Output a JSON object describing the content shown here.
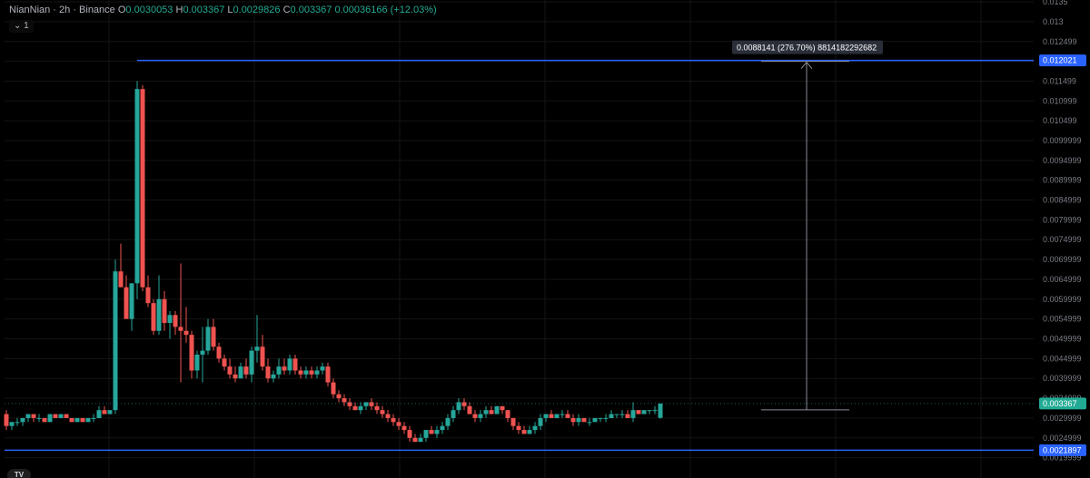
{
  "header": {
    "symbol": "NianNian · 2h · Binance",
    "open_label": "O",
    "open": "0.0030053",
    "high_label": "H",
    "high": "0.003367",
    "low_label": "L",
    "low": "0.0029826",
    "close_label": "C",
    "close": "0.003367",
    "change": "0.00036166 (+12.03%)",
    "collapse_label": "1",
    "collapse_icon": "chevron-down-icon"
  },
  "colors": {
    "up": "#26a69a",
    "down": "#ef5350",
    "bg": "#000000",
    "grid": "#141414",
    "blue_line": "#2962ff",
    "axis_text": "#7a7d85",
    "current_tag": "#22ab94"
  },
  "price_axis": {
    "ticks": [
      "0.0135",
      "0.013",
      "0.012499",
      "0.011999",
      "0.011499",
      "0.010999",
      "0.010499",
      "0.0099999",
      "0.0094999",
      "0.0089999",
      "0.0084999",
      "0.0079999",
      "0.0074999",
      "0.0069999",
      "0.0064999",
      "0.0059999",
      "0.0054999",
      "0.0049999",
      "0.0044999",
      "0.0039999",
      "0.0034999",
      "0.0029999",
      "0.0024999",
      "0.0019999"
    ],
    "upper_line_label": "0.012021",
    "lower_line_label": "0.0021897",
    "current_label": "0.003367"
  },
  "measure": {
    "label": "0.0088141 (276.70%) 8814182292682"
  },
  "logo": {
    "text": "TV"
  },
  "chart_data": {
    "type": "candlestick",
    "symbol": "NianNian",
    "interval": "2h",
    "exchange": "Binance",
    "ylim": [
      0.0019,
      0.0135
    ],
    "horizontal_lines": [
      0.012021,
      0.0021897
    ],
    "measure_from": 0.0032059,
    "measure_to": 0.012021,
    "candles": [
      [
        0.0031,
        0.0032,
        0.0027,
        0.0028
      ],
      [
        0.0028,
        0.0029,
        0.0027,
        0.0029
      ],
      [
        0.0029,
        0.003,
        0.0028,
        0.0029
      ],
      [
        0.0029,
        0.003,
        0.0028,
        0.003
      ],
      [
        0.003,
        0.0031,
        0.0029,
        0.0031
      ],
      [
        0.0031,
        0.0031,
        0.0029,
        0.003
      ],
      [
        0.003,
        0.0031,
        0.0029,
        0.003
      ],
      [
        0.003,
        0.003,
        0.0029,
        0.0029
      ],
      [
        0.0029,
        0.0031,
        0.0029,
        0.0031
      ],
      [
        0.0031,
        0.0031,
        0.003,
        0.003
      ],
      [
        0.003,
        0.0031,
        0.003,
        0.0031
      ],
      [
        0.0031,
        0.0031,
        0.003,
        0.003
      ],
      [
        0.003,
        0.003,
        0.0029,
        0.0029
      ],
      [
        0.0029,
        0.003,
        0.0029,
        0.003
      ],
      [
        0.003,
        0.003,
        0.0029,
        0.0029
      ],
      [
        0.0029,
        0.003,
        0.0029,
        0.003
      ],
      [
        0.003,
        0.0031,
        0.0029,
        0.003
      ],
      [
        0.003,
        0.0033,
        0.003,
        0.0032
      ],
      [
        0.0032,
        0.0033,
        0.0031,
        0.0031
      ],
      [
        0.0031,
        0.0032,
        0.0031,
        0.0032
      ],
      [
        0.0032,
        0.007,
        0.0031,
        0.0067
      ],
      [
        0.0067,
        0.0074,
        0.0065,
        0.0063
      ],
      [
        0.0063,
        0.0066,
        0.0055,
        0.0055
      ],
      [
        0.0055,
        0.0064,
        0.0052,
        0.0064
      ],
      [
        0.0064,
        0.0115,
        0.006,
        0.0113
      ],
      [
        0.0113,
        0.0114,
        0.0062,
        0.0063
      ],
      [
        0.0063,
        0.0066,
        0.0058,
        0.0059
      ],
      [
        0.0059,
        0.006,
        0.0051,
        0.0052
      ],
      [
        0.0052,
        0.0066,
        0.0051,
        0.006
      ],
      [
        0.006,
        0.0062,
        0.0052,
        0.0054
      ],
      [
        0.0054,
        0.0057,
        0.005,
        0.0056
      ],
      [
        0.0056,
        0.0057,
        0.0051,
        0.0053
      ],
      [
        0.0053,
        0.0069,
        0.0039,
        0.0052
      ],
      [
        0.0052,
        0.0058,
        0.0049,
        0.0051
      ],
      [
        0.0051,
        0.0052,
        0.004,
        0.0042
      ],
      [
        0.0042,
        0.0047,
        0.004,
        0.0046
      ],
      [
        0.0046,
        0.0053,
        0.0039,
        0.0047
      ],
      [
        0.0047,
        0.0055,
        0.0046,
        0.0053
      ],
      [
        0.0053,
        0.0055,
        0.0047,
        0.0048
      ],
      [
        0.0048,
        0.0049,
        0.0044,
        0.0045
      ],
      [
        0.0045,
        0.0046,
        0.0042,
        0.0043
      ],
      [
        0.0043,
        0.0045,
        0.004,
        0.0041
      ],
      [
        0.0041,
        0.0043,
        0.0039,
        0.004
      ],
      [
        0.004,
        0.0044,
        0.004,
        0.0043
      ],
      [
        0.0043,
        0.0045,
        0.004,
        0.0041
      ],
      [
        0.0041,
        0.0048,
        0.0039,
        0.0047
      ],
      [
        0.0047,
        0.0056,
        0.0044,
        0.0048
      ],
      [
        0.0048,
        0.0051,
        0.0042,
        0.0043
      ],
      [
        0.0043,
        0.0045,
        0.0039,
        0.004
      ],
      [
        0.004,
        0.0042,
        0.0039,
        0.0041
      ],
      [
        0.0041,
        0.0045,
        0.004,
        0.0043
      ],
      [
        0.0043,
        0.0045,
        0.0041,
        0.0042
      ],
      [
        0.0042,
        0.0046,
        0.0041,
        0.0045
      ],
      [
        0.0045,
        0.0046,
        0.0041,
        0.0042
      ],
      [
        0.0042,
        0.0043,
        0.004,
        0.0041
      ],
      [
        0.0041,
        0.0043,
        0.004,
        0.0042
      ],
      [
        0.0042,
        0.0043,
        0.004,
        0.0041
      ],
      [
        0.0041,
        0.0043,
        0.004,
        0.0042
      ],
      [
        0.0042,
        0.0044,
        0.0041,
        0.0043
      ],
      [
        0.0043,
        0.0044,
        0.0038,
        0.0039
      ],
      [
        0.0039,
        0.004,
        0.0035,
        0.0036
      ],
      [
        0.0036,
        0.0037,
        0.0034,
        0.0035
      ],
      [
        0.0035,
        0.0036,
        0.0033,
        0.0034
      ],
      [
        0.0034,
        0.0035,
        0.0032,
        0.0033
      ],
      [
        0.0033,
        0.0034,
        0.0032,
        0.0032
      ],
      [
        0.0032,
        0.0034,
        0.0031,
        0.0033
      ],
      [
        0.0033,
        0.0034,
        0.0032,
        0.0034
      ],
      [
        0.0034,
        0.0035,
        0.0032,
        0.0033
      ],
      [
        0.0033,
        0.0034,
        0.0031,
        0.0032
      ],
      [
        0.0032,
        0.0033,
        0.003,
        0.0031
      ],
      [
        0.0031,
        0.0032,
        0.0029,
        0.003
      ],
      [
        0.003,
        0.0031,
        0.0028,
        0.0029
      ],
      [
        0.0029,
        0.003,
        0.0027,
        0.0028
      ],
      [
        0.0028,
        0.0029,
        0.0026,
        0.0027
      ],
      [
        0.0027,
        0.0028,
        0.0024,
        0.0025
      ],
      [
        0.0025,
        0.0026,
        0.0024,
        0.0024
      ],
      [
        0.0024,
        0.0026,
        0.0024,
        0.0025
      ],
      [
        0.0025,
        0.0027,
        0.0024,
        0.0027
      ],
      [
        0.0027,
        0.0028,
        0.0026,
        0.0026
      ],
      [
        0.0026,
        0.0028,
        0.0025,
        0.0027
      ],
      [
        0.0027,
        0.0029,
        0.0026,
        0.0028
      ],
      [
        0.0028,
        0.0031,
        0.0027,
        0.003
      ],
      [
        0.003,
        0.0033,
        0.0029,
        0.0032
      ],
      [
        0.0032,
        0.0035,
        0.0031,
        0.0034
      ],
      [
        0.0034,
        0.0035,
        0.0032,
        0.0033
      ],
      [
        0.0033,
        0.0034,
        0.0031,
        0.0031
      ],
      [
        0.0031,
        0.0032,
        0.0029,
        0.003
      ],
      [
        0.003,
        0.0032,
        0.0029,
        0.0031
      ],
      [
        0.0031,
        0.0033,
        0.003,
        0.0032
      ],
      [
        0.0032,
        0.0033,
        0.0031,
        0.0031
      ],
      [
        0.0031,
        0.0033,
        0.0031,
        0.0033
      ],
      [
        0.0033,
        0.0033,
        0.0031,
        0.0032
      ],
      [
        0.0032,
        0.0032,
        0.0029,
        0.003
      ],
      [
        0.003,
        0.003,
        0.0027,
        0.0028
      ],
      [
        0.0028,
        0.0029,
        0.0026,
        0.0027
      ],
      [
        0.0027,
        0.0028,
        0.0026,
        0.0026
      ],
      [
        0.0026,
        0.0028,
        0.0026,
        0.0027
      ],
      [
        0.0027,
        0.0029,
        0.0026,
        0.0028
      ],
      [
        0.0028,
        0.0031,
        0.0027,
        0.003
      ],
      [
        0.003,
        0.0031,
        0.0029,
        0.0031
      ],
      [
        0.0031,
        0.0032,
        0.003,
        0.003
      ],
      [
        0.003,
        0.0031,
        0.003,
        0.0031
      ],
      [
        0.0031,
        0.0032,
        0.003,
        0.0031
      ],
      [
        0.0031,
        0.0032,
        0.003,
        0.003
      ],
      [
        0.003,
        0.0031,
        0.0028,
        0.0029
      ],
      [
        0.0029,
        0.0031,
        0.0028,
        0.003
      ],
      [
        0.003,
        0.003,
        0.0029,
        0.0029
      ],
      [
        0.0029,
        0.003,
        0.0028,
        0.0029
      ],
      [
        0.0029,
        0.003,
        0.0029,
        0.003
      ],
      [
        0.003,
        0.003,
        0.0029,
        0.003
      ],
      [
        0.003,
        0.0031,
        0.0029,
        0.003
      ],
      [
        0.003,
        0.0032,
        0.003,
        0.0031
      ],
      [
        0.0031,
        0.0031,
        0.003,
        0.0031
      ],
      [
        0.0031,
        0.0032,
        0.003,
        0.0031
      ],
      [
        0.0031,
        0.0032,
        0.003,
        0.003
      ],
      [
        0.003,
        0.0034,
        0.0029,
        0.0032
      ],
      [
        0.0032,
        0.0032,
        0.0031,
        0.0031
      ],
      [
        0.0031,
        0.0032,
        0.0031,
        0.0032
      ],
      [
        0.0032,
        0.0032,
        0.0031,
        0.0032
      ],
      [
        0.0032,
        0.0033,
        0.0031,
        0.0032
      ],
      [
        0.0030053,
        0.003367,
        0.0029826,
        0.003367
      ]
    ]
  }
}
